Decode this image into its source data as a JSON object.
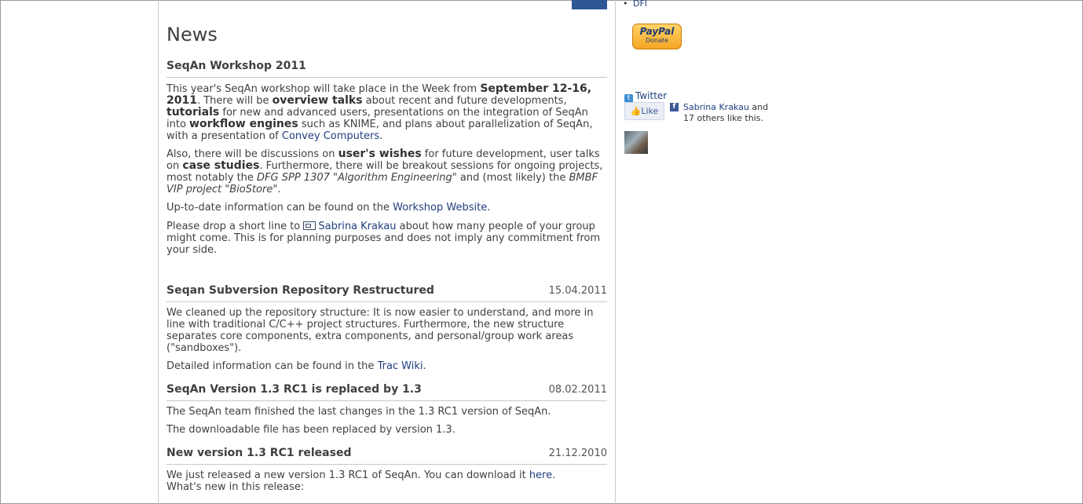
{
  "sidebar": {
    "dfi_link": "DFI",
    "paypal": {
      "brand": "PayPal",
      "label": "Donate"
    },
    "twitter_label": "Twitter",
    "like_label": "Like",
    "fb_name": "Sabrina Krakau",
    "fb_and": "and",
    "fb_others": "17 others like this."
  },
  "main": {
    "heading": "News",
    "items": [
      {
        "title": "SeqAn Workshop 2011",
        "date": ""
      },
      {
        "title": "Seqan Subversion Repository Restructured",
        "date": "15.04.2011",
        "p1": "We cleaned up the repository structure: It is now easier to understand, and more in line with traditional C/C++ project structures. Furthermore, the new structure separates core components, extra components, and personal/group work areas (\"sandboxes\").",
        "p2_pre": "Detailed information can be found in the ",
        "p2_link": "Trac Wiki",
        "p2_post": "."
      },
      {
        "title": "SeqAn Version 1.3 RC1 is replaced by 1.3",
        "date": "08.02.2011",
        "p1": "The SeqAn team finished the last changes in the 1.3 RC1 version of SeqAn.",
        "p2": "The downloadable file has been replaced by version 1.3."
      },
      {
        "title": "New version 1.3 RC1 released",
        "date": "21.12.2010",
        "p1_pre": "We just released a new version 1.3 RC1 of SeqAn. You can download it ",
        "p1_link": "here",
        "p1_post": ".",
        "p2": "What's new in this release:"
      }
    ],
    "workshop": {
      "a1": "This year's SeqAn workshop will take place in the Week from ",
      "a_b1": "September 12-16, 2011",
      "a2": ". There will be ",
      "a_b2": "overview talks",
      "a3": " about recent and future developments, ",
      "a_b3": "tutorials",
      "a4": " for new and advanced users, presentations on the integration of SeqAn into ",
      "a_b4": "workflow engines",
      "a5": " such as KNIME, and plans about parallelization of SeqAn, with a presentation of ",
      "a_link": "Convey Computers",
      "a6": ".",
      "b1": "Also, there will be discussions on ",
      "b_b1": "user's wishes",
      "b2": " for future development, user talks on ",
      "b_b2": "case studies",
      "b3": ". Furthermore, there will be breakout sessions for ongoing projects, most notably the ",
      "b_i1": "DFG SPP 1307 \"Algorithm Engineering\"",
      "b4": " and (most likely) the ",
      "b_i2": "BMBF VIP project \"BioStore\"",
      "b5": ".",
      "c1": "Up-to-date information can be found on the ",
      "c_link": "Workshop Website",
      "c2": ".",
      "d1": "Please drop a short line to ",
      "d_link": "Sabrina Krakau",
      "d2": " about how many people of your group might come. This is for planning purposes and does not imply any commitment from your side."
    }
  }
}
